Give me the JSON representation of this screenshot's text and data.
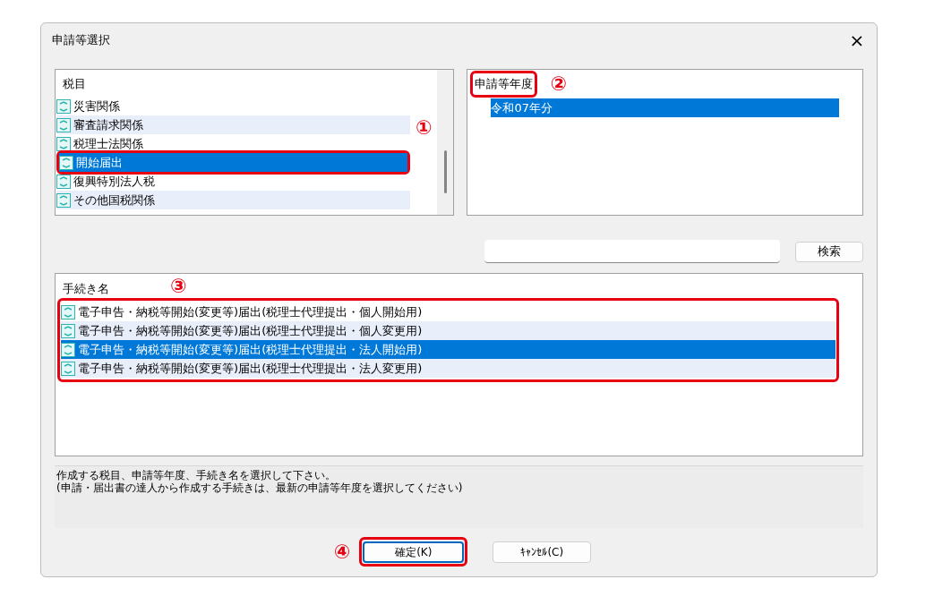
{
  "window": {
    "title": "申請等選択",
    "close": "×"
  },
  "tax_list": {
    "header": "税目",
    "items": [
      {
        "label": "災害関係",
        "selected": false
      },
      {
        "label": "審査請求関係",
        "selected": false
      },
      {
        "label": "税理士法関係",
        "selected": false
      },
      {
        "label": "開始届出",
        "selected": true
      },
      {
        "label": "復興特別法人税",
        "selected": false
      },
      {
        "label": "その他国税関係",
        "selected": false
      }
    ]
  },
  "year_list": {
    "header": "申請等年度",
    "items": [
      {
        "label": "令和07年分",
        "selected": true
      }
    ]
  },
  "search": {
    "button": "検索"
  },
  "procedure_list": {
    "header": "手続き名",
    "items": [
      {
        "label": "電子申告・納税等開始(変更等)届出(税理士代理提出・個人開始用)",
        "selected": false
      },
      {
        "label": "電子申告・納税等開始(変更等)届出(税理士代理提出・個人変更用)",
        "selected": false
      },
      {
        "label": "電子申告・納税等開始(変更等)届出(税理士代理提出・法人開始用)",
        "selected": true
      },
      {
        "label": "電子申告・納税等開始(変更等)届出(税理士代理提出・法人変更用)",
        "selected": false
      }
    ]
  },
  "message": [
    "作成する税目、申請等年度、手続き名を選択して下さい。",
    "(申請・届出書の達人から作成する手続きは、最新の申請等年度を選択してください)"
  ],
  "buttons": [
    {
      "label": "確定(K)",
      "selected": true
    },
    {
      "label": "ｷｬﾝｾﾙ(C)",
      "selected": false
    }
  ],
  "annotations": [
    {
      "label": "①"
    },
    {
      "label": "②"
    },
    {
      "label": "③"
    },
    {
      "label": "④"
    }
  ]
}
